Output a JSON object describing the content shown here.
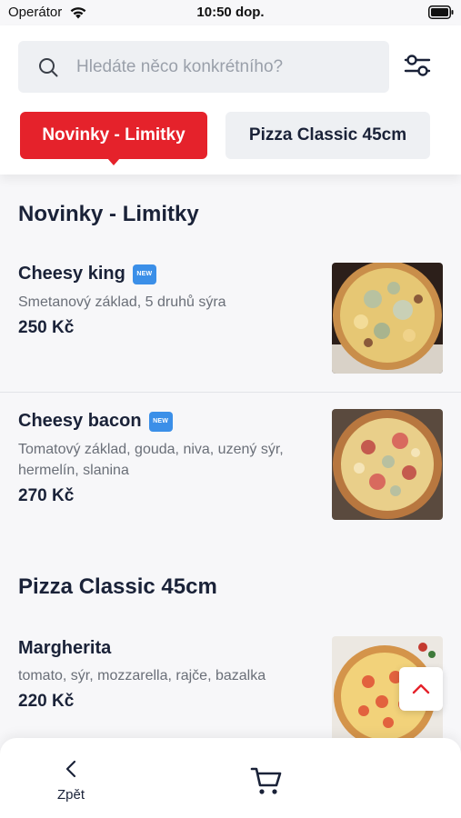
{
  "status_bar": {
    "carrier": "Operátor",
    "time": "10:50 dop."
  },
  "search": {
    "placeholder": "Hledáte něco konkrétního?",
    "value": ""
  },
  "categories": [
    {
      "label": "Novinky - Limitky",
      "active": true
    },
    {
      "label": "Pizza Classic 45cm",
      "active": false
    }
  ],
  "sections": [
    {
      "title": "Novinky - Limitky",
      "items": [
        {
          "name": "Cheesy king",
          "badge": "NEW",
          "description": "Smetanový základ, 5 druhů sýra",
          "price": "250 Kč"
        },
        {
          "name": "Cheesy bacon",
          "badge": "NEW",
          "description": "Tomatový základ, gouda, niva, uzený sýr, hermelín, slanina",
          "price": "270 Kč"
        }
      ]
    },
    {
      "title": "Pizza Classic 45cm",
      "items": [
        {
          "name": "Margherita",
          "description": "tomato, sýr, mozzarella, rajče, bazalka",
          "price": "220 Kč"
        }
      ]
    }
  ],
  "bottom_bar": {
    "back_label": "Zpět"
  },
  "colors": {
    "accent": "#e5222b",
    "text": "#1a2238",
    "muted": "#6a6f78",
    "chip_bg": "#eef0f3"
  },
  "icons": [
    "wifi-icon",
    "battery-icon",
    "search-icon",
    "filter-icon",
    "chevron-up-icon",
    "chevron-left-icon",
    "cart-icon"
  ]
}
